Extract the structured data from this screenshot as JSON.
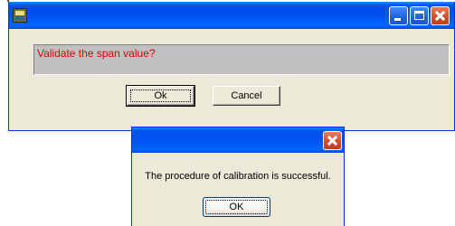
{
  "window1": {
    "message": "Validate the span value?",
    "buttons": {
      "ok": "Ok",
      "cancel": "Cancel"
    },
    "message_color": "#e00000"
  },
  "window2": {
    "message": "The procedure of calibration is successful.",
    "buttons": {
      "ok": "OK"
    }
  },
  "colors": {
    "titlebar": "#0054e3",
    "close_button": "#d04b2a",
    "dialog_face": "#ece9d8"
  },
  "icons": [
    "app-icon",
    "minimize-icon",
    "maximize-icon",
    "close-icon"
  ]
}
